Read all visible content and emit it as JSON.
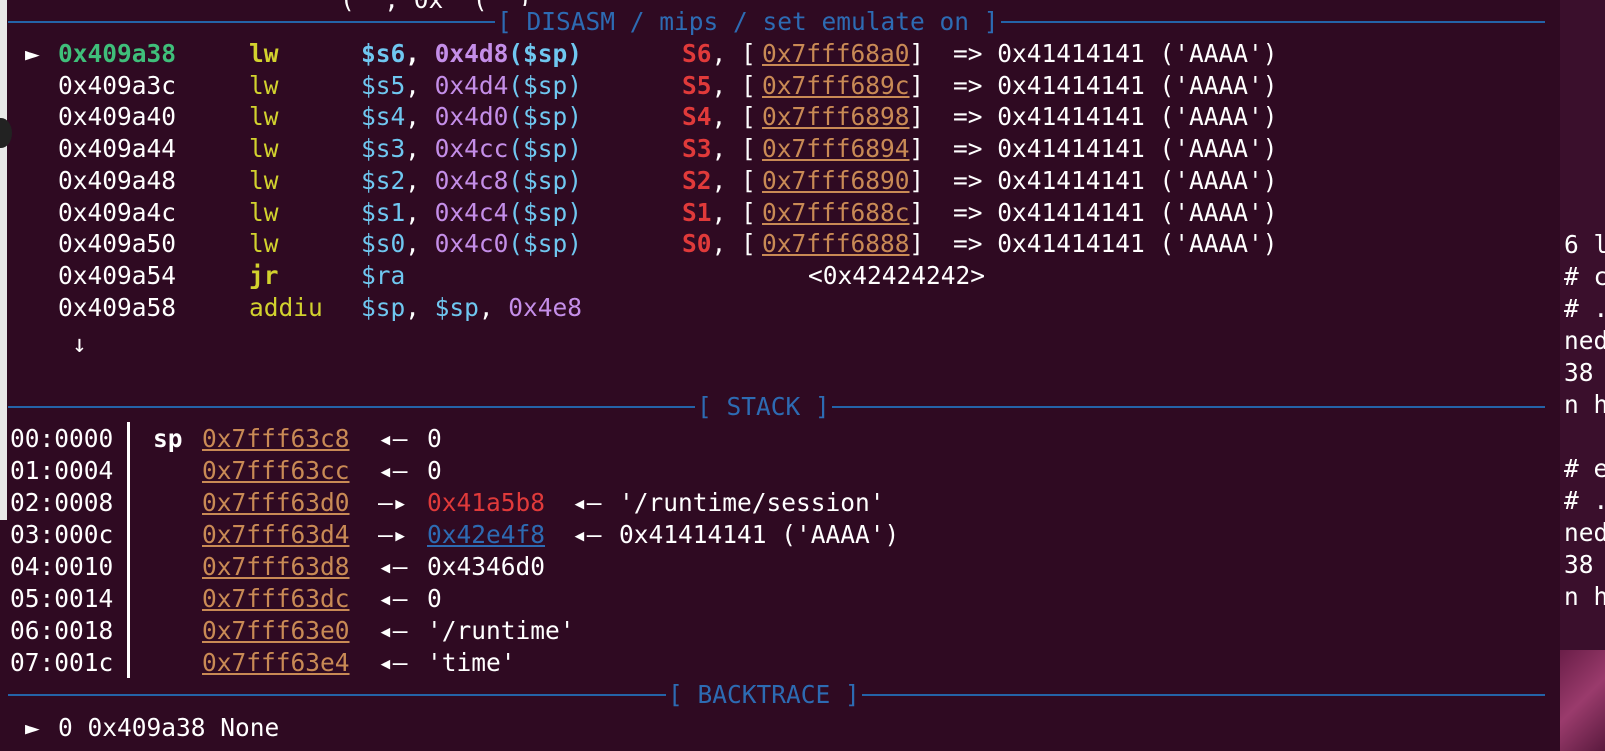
{
  "headers": {
    "disasm": "[ DISASM / mips / set emulate on ]",
    "stack": "[ STACK ]",
    "backtrace": "[ BACKTRACE ]"
  },
  "top_cut_text": "(  , 0x  (  )",
  "current_marker": "►",
  "disasm": [
    {
      "addr": "0x409a38",
      "mnemonic": "lw",
      "op1": "$s6",
      "op2": "0x4d8",
      "op3": "($sp)",
      "reg": "S6",
      "ptr": "0x7fff68a0",
      "value": "=> 0x41414141 ('AAAA')",
      "current": true
    },
    {
      "addr": "0x409a3c",
      "mnemonic": "lw",
      "op1": "$s5",
      "op2": "0x4d4",
      "op3": "($sp)",
      "reg": "S5",
      "ptr": "0x7fff689c",
      "value": "=> 0x41414141 ('AAAA')"
    },
    {
      "addr": "0x409a40",
      "mnemonic": "lw",
      "op1": "$s4",
      "op2": "0x4d0",
      "op3": "($sp)",
      "reg": "S4",
      "ptr": "0x7fff6898",
      "value": "=> 0x41414141 ('AAAA')"
    },
    {
      "addr": "0x409a44",
      "mnemonic": "lw",
      "op1": "$s3",
      "op2": "0x4cc",
      "op3": "($sp)",
      "reg": "S3",
      "ptr": "0x7fff6894",
      "value": "=> 0x41414141 ('AAAA')"
    },
    {
      "addr": "0x409a48",
      "mnemonic": "lw",
      "op1": "$s2",
      "op2": "0x4c8",
      "op3": "($sp)",
      "reg": "S2",
      "ptr": "0x7fff6890",
      "value": "=> 0x41414141 ('AAAA')"
    },
    {
      "addr": "0x409a4c",
      "mnemonic": "lw",
      "op1": "$s1",
      "op2": "0x4c4",
      "op3": "($sp)",
      "reg": "S1",
      "ptr": "0x7fff688c",
      "value": "=> 0x41414141 ('AAAA')"
    },
    {
      "addr": "0x409a50",
      "mnemonic": "lw",
      "op1": "$s0",
      "op2": "0x4c0",
      "op3": "($sp)",
      "reg": "S0",
      "ptr": "0x7fff6888",
      "value": "=> 0x41414141 ('AAAA')"
    }
  ],
  "disasm_jr": {
    "addr": "0x409a54",
    "mnemonic": "jr",
    "op1": "$ra",
    "target": "<0x42424242>"
  },
  "disasm_addiu": {
    "addr": "0x409a58",
    "mnemonic": "addiu",
    "op1": "$sp",
    "sep1": ", ",
    "op2": "$sp",
    "sep2": ", ",
    "op3": "0x4e8"
  },
  "down_arrow": "↓",
  "stack": [
    {
      "idx": "00:0000",
      "reg": "sp",
      "addr": "0x7fff63c8",
      "arrow": "◂—",
      "val": "0"
    },
    {
      "idx": "01:0004",
      "reg": "",
      "addr": "0x7fff63cc",
      "arrow": "◂—",
      "val": "0"
    },
    {
      "idx": "02:0008",
      "reg": "",
      "addr": "0x7fff63d0",
      "arrow": "—▸",
      "ptr": "0x41a5b8",
      "ptr_color": "red",
      "arrow2": "◂—",
      "val": "'/runtime/session'"
    },
    {
      "idx": "03:000c",
      "reg": "",
      "addr": "0x7fff63d4",
      "arrow": "—▸",
      "ptr": "0x42e4f8",
      "ptr_color": "blue",
      "arrow2": "◂—",
      "val": "0x41414141 ('AAAA')"
    },
    {
      "idx": "04:0010",
      "reg": "",
      "addr": "0x7fff63d8",
      "arrow": "◂—",
      "val": "0x4346d0"
    },
    {
      "idx": "05:0014",
      "reg": "",
      "addr": "0x7fff63dc",
      "arrow": "◂—",
      "val": "0"
    },
    {
      "idx": "06:0018",
      "reg": "",
      "addr": "0x7fff63e0",
      "arrow": "◂—",
      "val": "'/runtime'"
    },
    {
      "idx": "07:001c",
      "reg": "",
      "addr": "0x7fff63e4",
      "arrow": "◂—",
      "val": "'time'"
    }
  ],
  "backtrace": [
    {
      "marker": "►",
      "text": "0 0x409a38 None"
    }
  ],
  "right_pane_lines": [
    "6 l",
    "# ch",
    "# ./",
    "nedw",
    "38",
    "n ho",
    "",
    "# ec",
    "# ./",
    "nedw",
    "38",
    "n ho"
  ],
  "colors": {
    "background": "#2f0a22",
    "header_blue": "#2d6bb3",
    "address_green": "#3fbf7a",
    "mnemonic_yellow": "#d2d22e",
    "register_cyan": "#6fc7f0",
    "immediate_purple": "#c48ee8",
    "register_red": "#e03a3a",
    "pointer_orange": "#c98a55"
  }
}
